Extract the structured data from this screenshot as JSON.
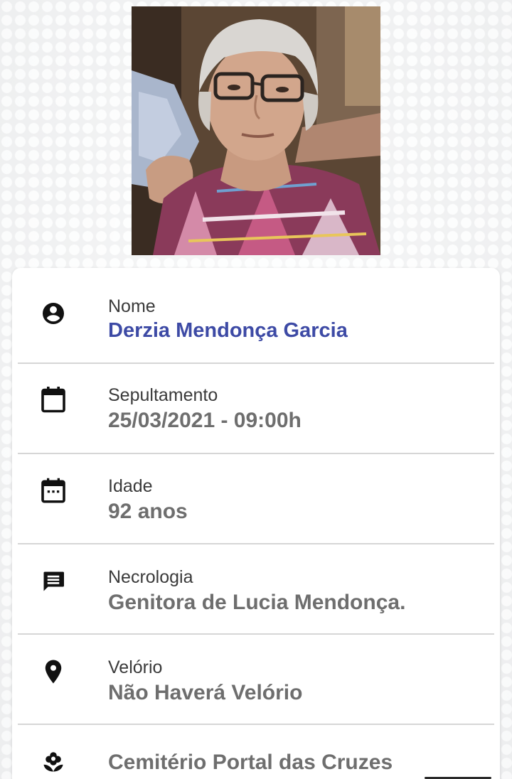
{
  "photo": {
    "alt": "portrait-photo"
  },
  "rows": [
    {
      "icon": "account-circle-icon",
      "label": "Nome",
      "value": "Derzia Mendonça Garcia"
    },
    {
      "icon": "calendar-icon",
      "label": "Sepultamento",
      "value": "25/03/2021 - 09:00h"
    },
    {
      "icon": "calendar-dots-icon",
      "label": "Idade",
      "value": "92 anos"
    },
    {
      "icon": "message-icon",
      "label": "Necrologia",
      "value": "Genitora de Lucia Mendonça."
    },
    {
      "icon": "location-pin-icon",
      "label": "Velório",
      "value": "Não Haverá Velório"
    },
    {
      "icon": "flower-icon",
      "label": "",
      "value": "Cemitério Portal das Cruzes"
    }
  ],
  "colors": {
    "name_accent": "#3d4aa5",
    "value_gray": "#6e6e6e",
    "label_dark": "#3a3a3a"
  }
}
